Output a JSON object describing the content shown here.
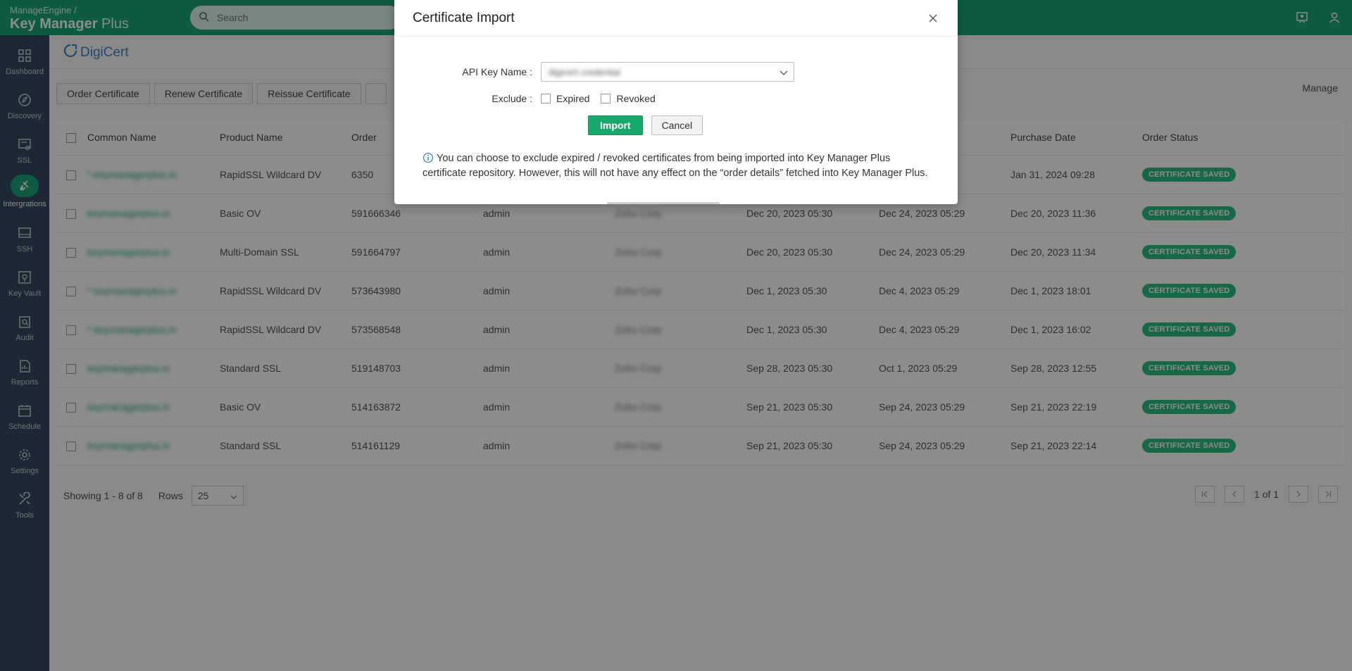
{
  "app": {
    "vendor": "ManageEngine /",
    "product_bold": "Key Manager",
    "product_light": " Plus"
  },
  "search": {
    "placeholder": "Search"
  },
  "sidebar": {
    "items": [
      {
        "label": "Dashboard",
        "icon": "dashboard-icon"
      },
      {
        "label": "Discovery",
        "icon": "discovery-icon"
      },
      {
        "label": "SSL",
        "icon": "ssl-icon"
      },
      {
        "label": "Intergrations",
        "icon": "integrations-icon",
        "active": true
      },
      {
        "label": "SSH",
        "icon": "ssh-icon"
      },
      {
        "label": "Key Vault",
        "icon": "key-vault-icon"
      },
      {
        "label": "Audit",
        "icon": "audit-icon"
      },
      {
        "label": "Reports",
        "icon": "reports-icon"
      },
      {
        "label": "Schedule",
        "icon": "schedule-icon"
      },
      {
        "label": "Settings",
        "icon": "settings-icon"
      },
      {
        "label": "Tools",
        "icon": "tools-icon"
      }
    ]
  },
  "page": {
    "title": "DigiCert",
    "toolbar": {
      "order": "Order Certificate",
      "renew": "Renew Certificate",
      "reissue": "Reissue Certificate"
    },
    "manage": "Manage"
  },
  "table": {
    "columns": [
      "Common Name",
      "Product Name",
      "Order",
      "",
      "",
      "",
      "",
      "Purchase Date",
      "Order Status"
    ],
    "rows": [
      {
        "cn": "*.keymanagerplus.in",
        "product": "RapidSSL Wildcard DV",
        "order": "6350",
        "user": "",
        "org": "",
        "start": "",
        "end": "5:29",
        "purchase": "Jan 31, 2024 09:28",
        "status": "CERTIFICATE SAVED"
      },
      {
        "cn": "keymanagerplus.in",
        "product": "Basic OV",
        "order": "591666346",
        "user": "admin",
        "org": "Zoho Corp",
        "start": "Dec 20, 2023 05:30",
        "end": "Dec 24, 2023 05:29",
        "purchase": "Dec 20, 2023 11:36",
        "status": "CERTIFICATE SAVED"
      },
      {
        "cn": "keymanagerplus.in",
        "product": "Multi-Domain SSL",
        "order": "591664797",
        "user": "admin",
        "org": "Zoho Corp",
        "start": "Dec 20, 2023 05:30",
        "end": "Dec 24, 2023 05:29",
        "purchase": "Dec 20, 2023 11:34",
        "status": "CERTIFICATE SAVED"
      },
      {
        "cn": "*.keymanagerplus.in",
        "product": "RapidSSL Wildcard DV",
        "order": "573643980",
        "user": "admin",
        "org": "Zoho Corp",
        "start": "Dec 1, 2023 05:30",
        "end": "Dec 4, 2023 05:29",
        "purchase": "Dec 1, 2023 18:01",
        "status": "CERTIFICATE SAVED"
      },
      {
        "cn": "*.keymanagerplus.in",
        "product": "RapidSSL Wildcard DV",
        "order": "573568548",
        "user": "admin",
        "org": "Zoho Corp",
        "start": "Dec 1, 2023 05:30",
        "end": "Dec 4, 2023 05:29",
        "purchase": "Dec 1, 2023 16:02",
        "status": "CERTIFICATE SAVED"
      },
      {
        "cn": "keymanagerplus.in",
        "product": "Standard SSL",
        "order": "519148703",
        "user": "admin",
        "org": "Zoho Corp",
        "start": "Sep 28, 2023 05:30",
        "end": "Oct 1, 2023 05:29",
        "purchase": "Sep 28, 2023 12:55",
        "status": "CERTIFICATE SAVED"
      },
      {
        "cn": "keymanagerplus.in",
        "product": "Basic OV",
        "order": "514163872",
        "user": "admin",
        "org": "Zoho Corp",
        "start": "Sep 21, 2023 05:30",
        "end": "Sep 24, 2023 05:29",
        "purchase": "Sep 21, 2023 22:19",
        "status": "CERTIFICATE SAVED"
      },
      {
        "cn": "keymanagerplus.in",
        "product": "Standard SSL",
        "order": "514161129",
        "user": "admin",
        "org": "Zoho Corp",
        "start": "Sep 21, 2023 05:30",
        "end": "Sep 24, 2023 05:29",
        "purchase": "Sep 21, 2023 22:14",
        "status": "CERTIFICATE SAVED"
      }
    ]
  },
  "footer": {
    "showing": "Showing 1 - 8 of 8",
    "rows_label": "Rows",
    "rows_value": "25",
    "page_info": "1 of 1"
  },
  "modal": {
    "title": "Certificate Import",
    "api_key_label": "API Key Name :",
    "api_key_value": "digicert credential",
    "exclude_label": "Exclude :",
    "expired_label": "Expired",
    "revoked_label": "Revoked",
    "import_button": "Import",
    "cancel_button": "Cancel",
    "note": "You can choose to exclude expired / revoked certificates from being imported into Key Manager Plus certificate repository. However, this will not have any effect on the “order details” fetched into Key Manager Plus."
  },
  "colors": {
    "brand": "#1aa67a",
    "sidebar": "#33495d",
    "badge": "#2bbd80",
    "import": "#18a86b"
  }
}
